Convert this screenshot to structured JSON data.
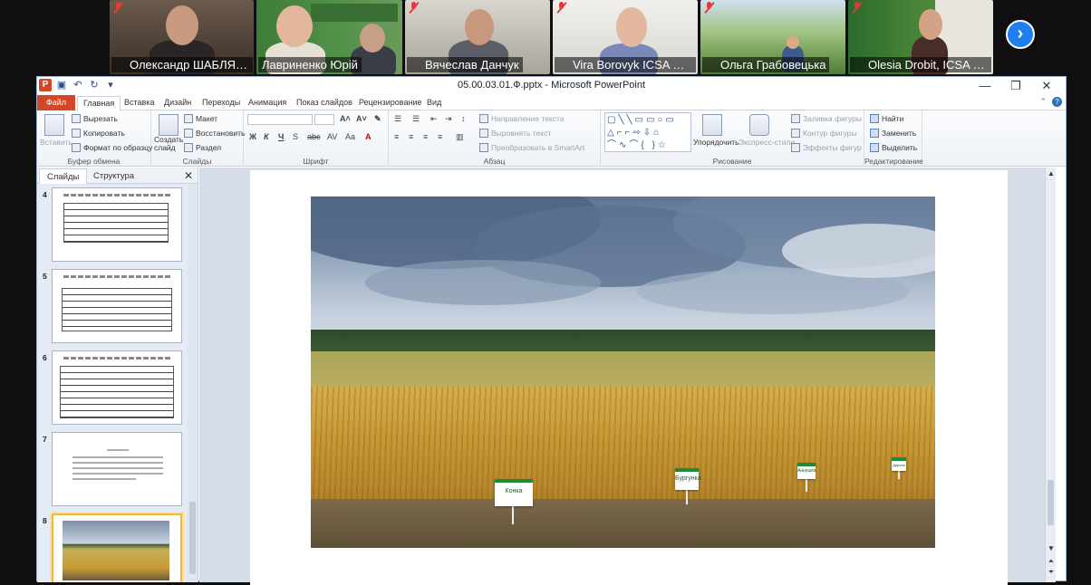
{
  "meeting": {
    "participants": [
      {
        "name": "Олександр ШАБЛЯ І...",
        "muted": true
      },
      {
        "name": "Лавриненко Юрій",
        "muted": false
      },
      {
        "name": "Вячеслав Данчук",
        "muted": true
      },
      {
        "name": "Vira Borovyk ICSA NA...",
        "muted": true
      },
      {
        "name": "Ольга Грабовецька",
        "muted": true
      },
      {
        "name": "Olesia Drobit, ICSA N...",
        "muted": true
      }
    ],
    "next_icon": "chevron-right-icon"
  },
  "ppt": {
    "window_title": "05.00.03.01.Ф.pptx  -  Microsoft PowerPoint",
    "tabs": {
      "file": "Файл",
      "items": [
        "Главная",
        "Вставка",
        "Дизайн",
        "Переходы",
        "Анимация",
        "Показ слайдов",
        "Рецензирование",
        "Вид"
      ]
    },
    "ribbon": {
      "clipboard": {
        "label": "Буфер обмена",
        "paste": "Вставить",
        "cut": "Вырезать",
        "copy": "Копировать",
        "format_painter": "Формат по образцу"
      },
      "slides": {
        "label": "Слайды",
        "new_slide": "Создать слайд",
        "layout": "Макет",
        "reset": "Восстановить",
        "section": "Раздел"
      },
      "font": {
        "label": "Шрифт"
      },
      "paragraph": {
        "label": "Абзац",
        "text_direction": "Направление текста",
        "align_text": "Выровнять текст",
        "smartart": "Преобразовать в SmartArt"
      },
      "drawing": {
        "label": "Рисование",
        "arrange": "Упорядочить",
        "quick_styles": "Экспресс-стили",
        "shape_fill": "Заливка фигуры",
        "shape_outline": "Контур фигуры",
        "shape_effects": "Эффекты фигур"
      },
      "editing": {
        "label": "Редактирование",
        "find": "Найти",
        "replace": "Заменить",
        "select": "Выделить"
      }
    },
    "pane": {
      "tab_slides": "Слайды",
      "tab_outline": "Структура",
      "slide_numbers": [
        "4",
        "5",
        "6",
        "7",
        "8"
      ]
    },
    "slide": {
      "signs": [
        "Конка",
        "Бургунка",
        "Аннушка",
        "Дарина"
      ]
    }
  }
}
